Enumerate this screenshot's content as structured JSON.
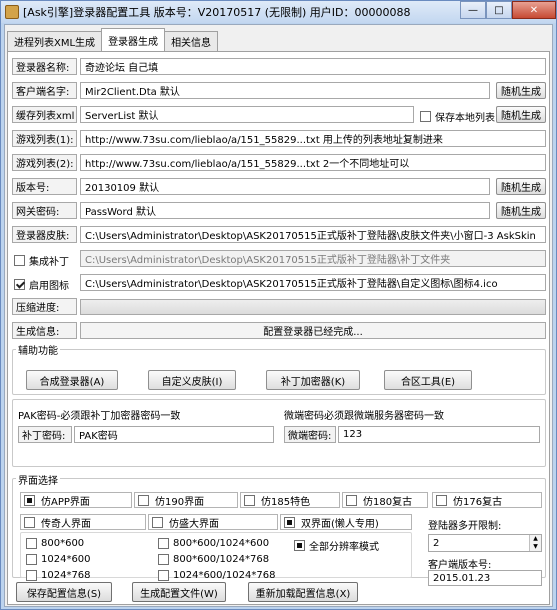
{
  "window": {
    "title": "[Ask引擎]登录器配置工具  版本号：V20170517 (无限制) 用户ID：00000088",
    "minimize": "—",
    "maximize": "□",
    "close": "✕"
  },
  "tabs": [
    "进程列表XML生成",
    "登录器生成",
    "相关信息"
  ],
  "form": {
    "login_name": {
      "label": "登录器名称:",
      "value": "奇迹论坛 自己填"
    },
    "client_name": {
      "label": "客户端名字:",
      "value": "Mir2Client.Dta 默认",
      "button": "随机生成"
    },
    "cache_list": {
      "label": "缓存列表xml",
      "value": "ServerList 默认",
      "checkbox": "保存本地列表",
      "button": "随机生成"
    },
    "game_list1": {
      "label": "游戏列表(1):",
      "value": "http://www.73su.com/lieblao/a/151_55829...txt 用上传的列表地址复制进来"
    },
    "game_list2": {
      "label": "游戏列表(2):",
      "value": "http://www.73su.com/lieblao/a/151_55829...txt 2一个不同地址可以"
    },
    "version": {
      "label": "版本号:",
      "value": "20130109 默认",
      "button": "随机生成"
    },
    "password": {
      "label": "网关密码:",
      "value": "PassWord 默认",
      "button": "随机生成"
    },
    "skin": {
      "label": "登录器皮肤:",
      "value": "C:\\Users\\Administrator\\Desktop\\ASK20170515正式版补丁登陆器\\皮肤文件夹\\小窗口-3 AskSkin"
    },
    "patch": {
      "label": "集成补丁",
      "value": "C:\\Users\\Administrator\\Desktop\\ASK20170515正式版补丁登陆器\\补丁文件夹"
    },
    "icon": {
      "label": "启用图标",
      "value": "C:\\Users\\Administrator\\Desktop\\ASK20170515正式版补丁登陆器\\自定义图标\\图标4.ico"
    },
    "progress": {
      "label": "压缩进度:",
      "value": 0
    },
    "gen_info": {
      "label": "生成信息:",
      "value": "配置登录器已经完成..."
    }
  },
  "assist": {
    "title": "辅助功能",
    "buttons": [
      "合成登录器(A)",
      "自定义皮肤(I)",
      "补丁加密器(K)",
      "合区工具(E)"
    ]
  },
  "pak": {
    "note_left": "PAK密码-必须跟补丁加密器密码一致",
    "note_right": "微端密码必须跟微端服务器密码一致",
    "patch_pwd_label": "补丁密码:",
    "patch_pwd_value": "PAK密码",
    "micro_pwd_label": "微端密码:",
    "micro_pwd_value": "123"
  },
  "ui": {
    "title": "界面选择",
    "row1": [
      "仿APP界面",
      "仿190界面",
      "仿185特色",
      "仿180复古",
      "仿176复古"
    ],
    "row2": [
      "传奇人界面",
      "仿盛大界面",
      "双界面(懒人专用)"
    ],
    "res_left": [
      "800*600",
      "1024*600",
      "1024*768"
    ],
    "res_mid": [
      "800*600/1024*600",
      "800*600/1024*768",
      "1024*600/1024*768"
    ],
    "res_right": "全部分辨率模式",
    "multi_label": "登陆器多开限制:",
    "multi_value": "2",
    "client_ver_label": "客户端版本号:",
    "client_ver_value": "2015.01.23"
  },
  "bottom": [
    "保存配置信息(S)",
    "生成配置文件(W)",
    "重新加载配置信息(X)"
  ]
}
